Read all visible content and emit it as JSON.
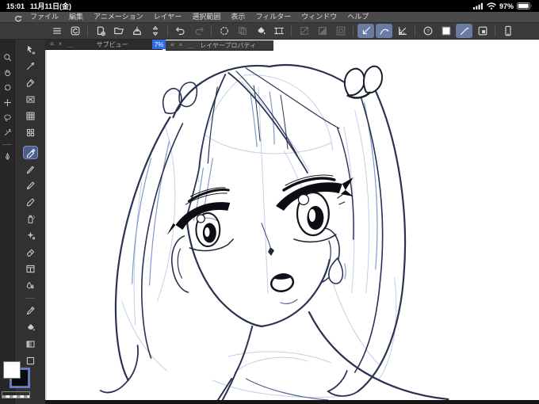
{
  "status_bar": {
    "time": "15:01",
    "date": "11月11日(金)",
    "battery_percent": "97%",
    "icons": [
      "cellular-signal-icon",
      "wifi-icon",
      "battery-icon"
    ]
  },
  "menu_bar": {
    "logo": "clip-studio-logo",
    "items": [
      "ファイル",
      "編集",
      "アニメーション",
      "レイヤー",
      "選択範囲",
      "表示",
      "フィルター",
      "ウィンドウ",
      "ヘルプ"
    ]
  },
  "toolbar": {
    "buttons": [
      {
        "name": "main-menu",
        "icon": "menu",
        "state": "normal"
      },
      {
        "name": "clip-studio",
        "icon": "clipstudio",
        "state": "normal"
      },
      {
        "sep": true
      },
      {
        "name": "new-canvas",
        "icon": "newfile",
        "state": "normal"
      },
      {
        "name": "open-file",
        "icon": "openfile",
        "state": "normal"
      },
      {
        "name": "save-file",
        "icon": "savefile",
        "state": "normal"
      },
      {
        "name": "sync",
        "icon": "sync",
        "state": "normal"
      },
      {
        "sep": true
      },
      {
        "name": "undo",
        "icon": "undo",
        "state": "normal"
      },
      {
        "name": "redo",
        "icon": "redo",
        "state": "disabled"
      },
      {
        "sep": true
      },
      {
        "name": "processing",
        "icon": "spinner",
        "state": "normal"
      },
      {
        "name": "paste",
        "icon": "paste",
        "state": "disabled"
      },
      {
        "name": "fill",
        "icon": "bucket",
        "state": "normal"
      },
      {
        "name": "crop",
        "icon": "crop",
        "state": "normal"
      },
      {
        "sep": true
      },
      {
        "name": "deselect",
        "icon": "deselect",
        "state": "disabled"
      },
      {
        "name": "invert-selection",
        "icon": "invert",
        "state": "disabled"
      },
      {
        "name": "selection-border",
        "icon": "border",
        "state": "disabled"
      },
      {
        "sep": true
      },
      {
        "name": "snap-to-ruler",
        "icon": "snapruler",
        "state": "selected"
      },
      {
        "name": "snap-to-special-ruler",
        "icon": "snapspecial",
        "state": "selected"
      },
      {
        "name": "snap-to-grid",
        "icon": "snapgrid",
        "state": "normal"
      },
      {
        "sep": true
      },
      {
        "name": "reset-display",
        "icon": "resetview",
        "state": "normal"
      },
      {
        "name": "current-color-chip",
        "icon": "colorchip",
        "state": "normal"
      },
      {
        "name": "draw-mode",
        "icon": "drawline",
        "state": "selected"
      },
      {
        "name": "material",
        "icon": "material",
        "state": "normal"
      },
      {
        "sep": true
      },
      {
        "name": "device",
        "icon": "tablet",
        "state": "normal"
      }
    ]
  },
  "palettes": {
    "subview": {
      "title": "サブビュー",
      "controls": {
        "menu": "≡",
        "close": "×",
        "minimize": "＿"
      },
      "zoom_value": "7%"
    },
    "layer_property": {
      "title": "レイヤープロパティ",
      "controls": {
        "menu": "≡",
        "close": "×",
        "minimize": "＿"
      }
    }
  },
  "sidebar": {
    "column_a": [
      {
        "name": "zoom-tool",
        "icon": "zoom"
      },
      {
        "name": "hand-tool",
        "icon": "hand"
      },
      {
        "name": "rotate-view-tool",
        "icon": "rotateview"
      },
      {
        "name": "move-tool",
        "icon": "move"
      },
      {
        "name": "lasso-tool",
        "icon": "lasso"
      },
      {
        "name": "auto-select-tool",
        "icon": "wand"
      },
      {
        "divider": true
      },
      {
        "name": "quill-tool",
        "icon": "quill"
      }
    ],
    "column_b": [
      {
        "name": "operation-tool",
        "icon": "operation"
      },
      {
        "name": "layer-move-tool",
        "icon": "layermove"
      },
      {
        "name": "selection-pen-tool",
        "icon": "selpen"
      },
      {
        "name": "delete-selection-tool",
        "icon": "deletex"
      },
      {
        "name": "grid-panel-tool",
        "icon": "gridpanel"
      },
      {
        "name": "material-panel-tool",
        "icon": "dotspanel"
      },
      {
        "name": "marker-tool",
        "icon": "marker",
        "state": "selected",
        "pregap": true
      },
      {
        "name": "pen-tool",
        "icon": "pen"
      },
      {
        "name": "pencil-tool",
        "icon": "pencil"
      },
      {
        "name": "brush-tool",
        "icon": "brush"
      },
      {
        "name": "airbrush-tool",
        "icon": "airbrush"
      },
      {
        "name": "decoration-tool",
        "icon": "decoration"
      },
      {
        "name": "eraser-tool",
        "icon": "eraser"
      },
      {
        "name": "frame-panel-tool",
        "icon": "panel"
      },
      {
        "name": "blend-tool",
        "icon": "blend"
      },
      {
        "divider": true
      },
      {
        "name": "eyedropper-tool",
        "icon": "dropper"
      },
      {
        "name": "fill-tool",
        "icon": "bucket"
      },
      {
        "name": "gradient-tool",
        "icon": "gradient"
      },
      {
        "name": "figure-tool",
        "icon": "figure"
      }
    ],
    "foreground_color": "#ffffff",
    "background_color": "#0a0a12"
  },
  "canvas": {
    "artwork": "Blue pencil sketch of an anime girl with long twin tails tied with ribbons, inked black eyes and eyebrows, small open mouth, sweat drop on cheek, bare shoulders"
  },
  "colors": {
    "selected_button_bg": "#6a7ba4",
    "selected_tool_bg": "#4c5f8c",
    "zoom_chip_bg": "#2f6be4",
    "status_bar_bg": "#000000",
    "menu_bar_bg": "#4a4a4a",
    "toolbar_bg": "#3b3b3b",
    "sidebar_bg": "#313131",
    "canvas_bg": "#ffffff",
    "sketch_blue": "#bcc9e8",
    "ink_blue": "#2a3252"
  }
}
